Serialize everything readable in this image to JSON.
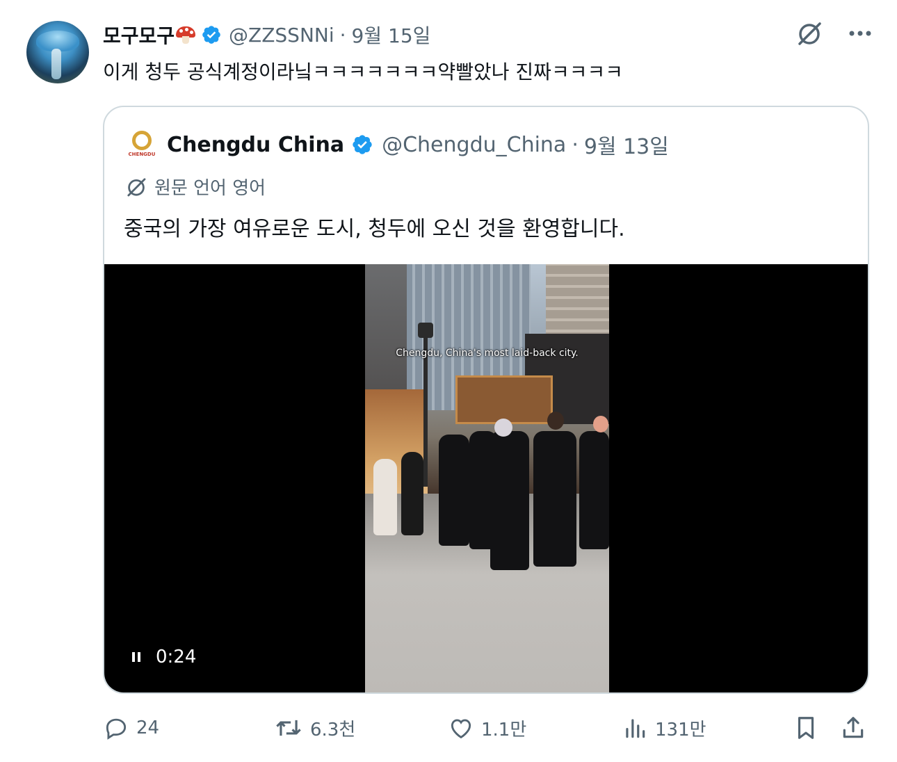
{
  "tweet": {
    "display_name": "모구모구",
    "name_emoji": "mushroom-emoji",
    "verified_icon": "verified-badge-icon",
    "handle": "@ZZSSNNi",
    "separator": "·",
    "date": "9월 15일",
    "text": "이게 청두 공식계정이라닠ㅋㅋㅋㅋㅋㅋㅋ약빨았나 진짜ㅋㅋㅋㅋ"
  },
  "top_icons": [
    "grok-icon",
    "more-icon"
  ],
  "quoted": {
    "display_name": "Chengdu China",
    "avatar_text": "CHENGDU",
    "handle": "@Chengdu_China",
    "separator": "·",
    "date": "9월 13일",
    "translate_label": "원문 언어 영어",
    "text": "중국의 가장 여유로운 도시, 청두에 오신 것을 환영합니다.",
    "video": {
      "caption": "Chengdu, China's most laid-back city.",
      "time": "0:24",
      "state": "playing"
    }
  },
  "actions": {
    "reply_count": "24",
    "retweet_count": "6.3천",
    "like_count": "1.1만",
    "view_count": "131만"
  },
  "colors": {
    "text_primary": "#0f1419",
    "text_secondary": "#536471",
    "verified": "#1d9bf0",
    "border": "#cfd9de"
  }
}
